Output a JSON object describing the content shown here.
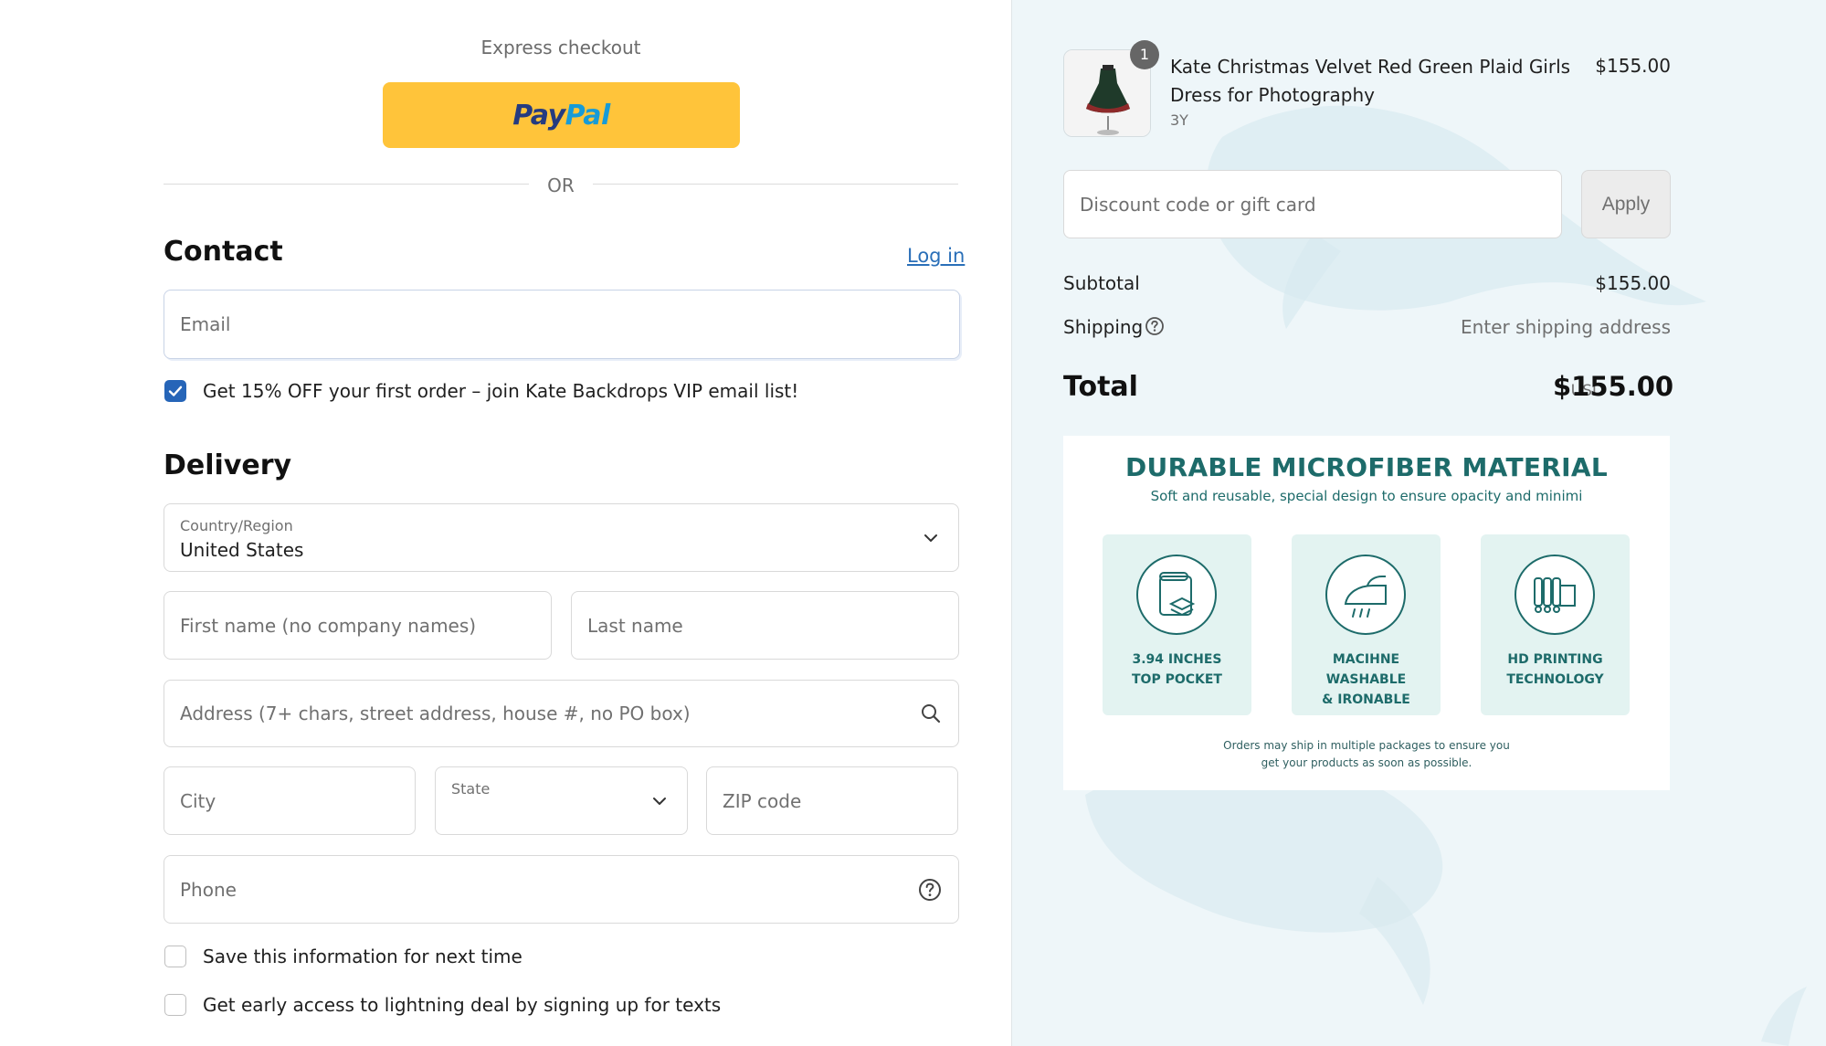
{
  "express": {
    "label": "Express checkout",
    "paypal_left": "Pay",
    "paypal_right": "Pal"
  },
  "divider": {
    "or": "OR"
  },
  "contact": {
    "heading": "Contact",
    "login": "Log in",
    "email_placeholder": "Email",
    "vip_checked": true,
    "vip_label": "Get 15% OFF your first order – join Kate Backdrops VIP email list!"
  },
  "delivery": {
    "heading": "Delivery",
    "country_label": "Country/Region",
    "country_value": "United States",
    "first_name_placeholder": "First name (no company names)",
    "last_name_placeholder": "Last name",
    "address_placeholder": "Address (7+ chars, street address, house #, no PO box)",
    "city_placeholder": "City",
    "state_label": "State",
    "zip_placeholder": "ZIP code",
    "phone_placeholder": "Phone",
    "save_info_label": "Save this information for next time",
    "save_info_checked": false,
    "texts_label": "Get early access to lightning deal by signing up for texts",
    "texts_checked": false
  },
  "order": {
    "item": {
      "quantity": "1",
      "title": "Kate Christmas Velvet Red Green Plaid Girls Dress for Photography",
      "variant": "3Y",
      "price": "$155.00"
    },
    "discount_placeholder": "Discount code or gift card",
    "apply_label": "Apply",
    "subtotal_label": "Subtotal",
    "subtotal_value": "$155.00",
    "shipping_label": "Shipping",
    "shipping_value": "Enter shipping address",
    "total_label": "Total",
    "total_currency": "USD",
    "total_value": "$155.00"
  },
  "banner": {
    "title": "DURABLE MICROFIBER MATERIAL",
    "subtitle": "Soft and reusable, special  design to ensure opacity and minimi",
    "tiles": [
      {
        "line1": "3.94 INCHES",
        "line2": "TOP POCKET"
      },
      {
        "line1": "MACIHNE WASHABLE",
        "line2": "& IRONABLE"
      },
      {
        "line1": "HD PRINTING",
        "line2": "TECHNOLOGY"
      }
    ],
    "note_line1": "Orders may ship in multiple packages to ensure you",
    "note_line2": "get your products as soon as possible."
  },
  "colors": {
    "paypal_yellow": "#ffc43a",
    "link_blue": "#2a6fb8",
    "checkbox_blue": "#2665b8",
    "banner_teal": "#1d6b6a",
    "right_panel_bg": "#eef6f9"
  }
}
